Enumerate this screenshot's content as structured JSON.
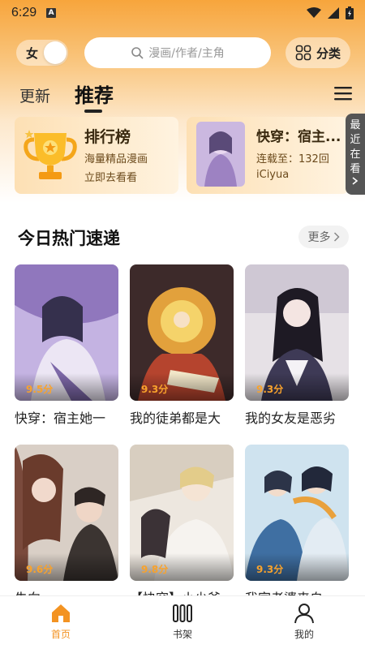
{
  "status_bar": {
    "time": "6:29",
    "notif_letter": "A"
  },
  "header": {
    "gender_label": "女",
    "search_placeholder": "漫画/作者/主角",
    "category_label": "分类"
  },
  "tabs": [
    {
      "label": "更新",
      "active": false
    },
    {
      "label": "推荐",
      "active": true
    }
  ],
  "rank_card": {
    "title": "排行榜",
    "subtitle": "海量精品漫画",
    "cta": "立即去看看"
  },
  "recent_card": {
    "title": "快穿：宿主...",
    "chapter": "连载至：132回",
    "author": "iCiyua"
  },
  "recent_tab": {
    "chars": [
      "最",
      "近",
      "在",
      "看"
    ]
  },
  "section": {
    "title": "今日热门速递",
    "more_label": "更多"
  },
  "comics": [
    {
      "name": "快穿：宿主她一",
      "score": "9.5分",
      "cover_color": "#b7a2d6"
    },
    {
      "name": "我的徒弟都是大",
      "score": "9.3分",
      "cover_color": "#d6893b"
    },
    {
      "name": "我的女友是恶劣",
      "score": "9.3分",
      "cover_color": "#6f6480"
    },
    {
      "name": "失向",
      "score": "9.6分",
      "cover_color": "#8c5a4a"
    },
    {
      "name": "【快穿】小少爷",
      "score": "9.8分",
      "cover_color": "#d9cfc3"
    },
    {
      "name": "我家老婆来自",
      "score": "9.3分",
      "cover_color": "#7aa6c7"
    }
  ],
  "bottom_nav": [
    {
      "label": "首页",
      "icon": "home-icon",
      "active": true
    },
    {
      "label": "书架",
      "icon": "bookshelf-icon",
      "active": false
    },
    {
      "label": "我的",
      "icon": "profile-icon",
      "active": false
    }
  ],
  "colors": {
    "accent": "#f39322",
    "score": "#f8a22c"
  }
}
